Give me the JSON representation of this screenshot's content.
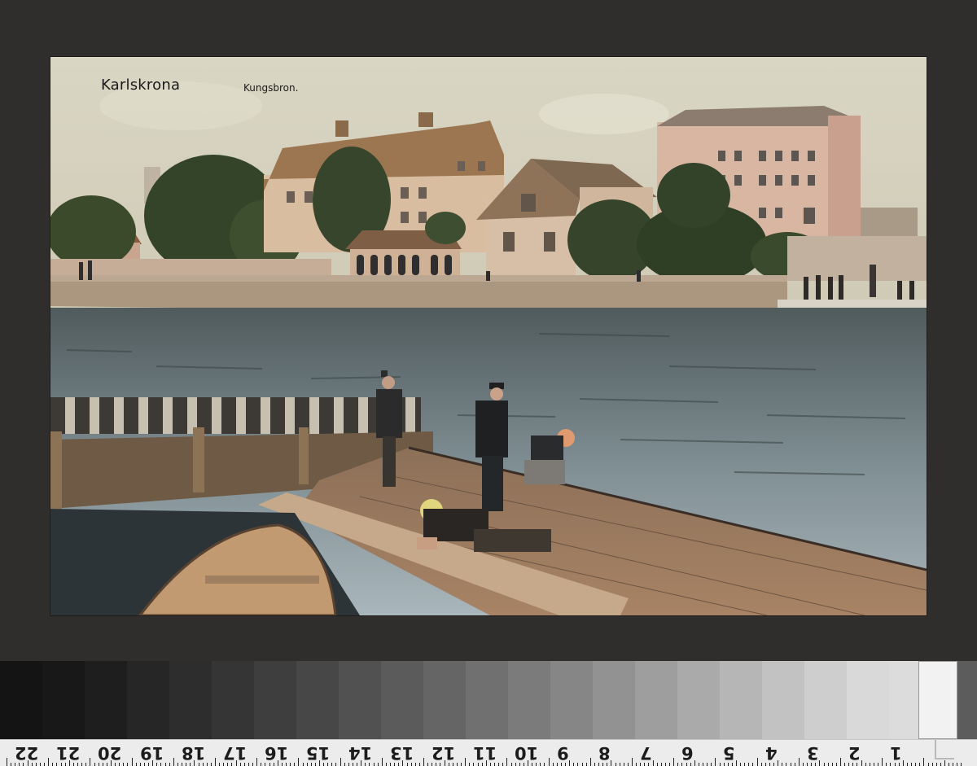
{
  "postcard": {
    "title": "Karlskrona",
    "subtitle": "Kungsbron."
  },
  "scan_target": {
    "ruler_numbers": [
      "22",
      "21",
      "20",
      "19",
      "18",
      "17",
      "16",
      "15",
      "14",
      "13",
      "12",
      "11",
      "10",
      "9",
      "8",
      "7",
      "6",
      "5",
      "4",
      "3",
      "2",
      "1"
    ]
  }
}
